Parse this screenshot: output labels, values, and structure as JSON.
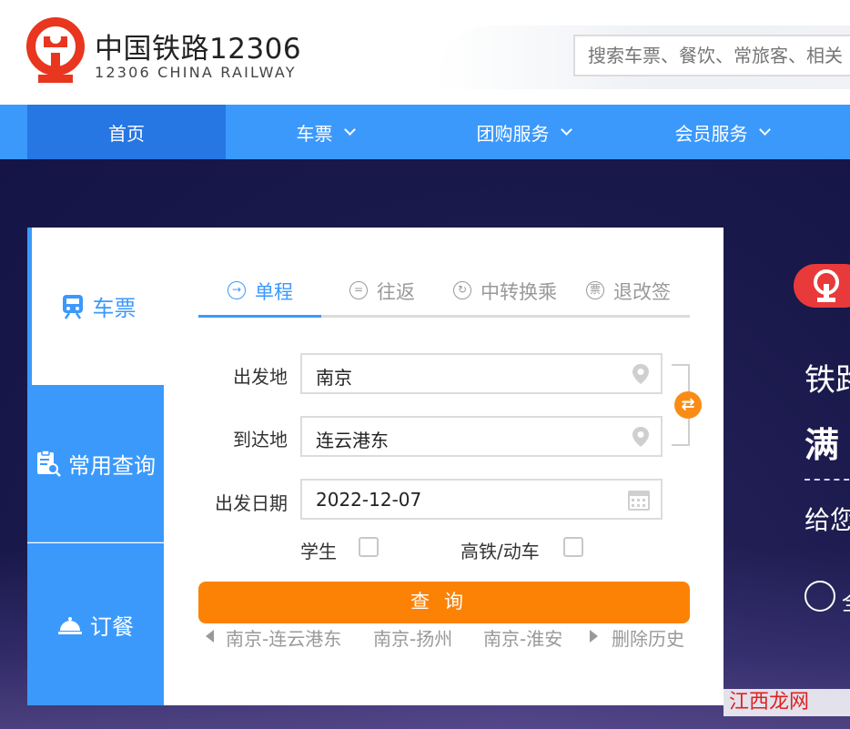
{
  "header": {
    "site_name_cn": "中国铁路12306",
    "site_name_en": "12306 CHINA RAILWAY",
    "search_placeholder": "搜索车票、餐饮、常旅客、相关"
  },
  "nav": {
    "items": [
      {
        "label": "首页",
        "active": true,
        "dropdown": false
      },
      {
        "label": "车票",
        "active": false,
        "dropdown": true
      },
      {
        "label": "团购服务",
        "active": false,
        "dropdown": true
      },
      {
        "label": "会员服务",
        "active": false,
        "dropdown": true
      }
    ]
  },
  "sidebar": {
    "items": [
      {
        "label": "车票",
        "icon": "train-icon",
        "active": true
      },
      {
        "label": "常用查询",
        "icon": "clipboard-search-icon",
        "active": false
      },
      {
        "label": "订餐",
        "icon": "food-cover-icon",
        "active": false
      }
    ]
  },
  "ticket": {
    "tabs": [
      {
        "label": "单程",
        "icon": "arrow-circle-icon",
        "active": true
      },
      {
        "label": "往返",
        "icon": "equals-circle-icon",
        "active": false
      },
      {
        "label": "中转换乘",
        "icon": "cycle-circle-icon",
        "active": false
      },
      {
        "label": "退改签",
        "icon": "ticket-circle-icon",
        "active": false
      }
    ],
    "from_label": "出发地",
    "from_value": "南京",
    "to_label": "到达地",
    "to_value": "连云港东",
    "date_label": "出发日期",
    "date_value": "2022-12-07",
    "student_label": "学生",
    "student_checked": false,
    "highspeed_label": "高铁/动车",
    "highspeed_checked": false,
    "query_label": "查询",
    "history": [
      "南京-连云港东",
      "南京-扬州",
      "南京-淮安"
    ],
    "delete_history_label": "删除历史"
  },
  "promo": {
    "line1": "铁路",
    "line2": "满",
    "line3": "给您",
    "phone_text": "全"
  },
  "watermark": "江西龙网",
  "colors": {
    "primary": "#3b99fc",
    "primary_dark": "#2676e3",
    "accent_orange": "#fc8206",
    "brand_red": "#e8361f"
  }
}
